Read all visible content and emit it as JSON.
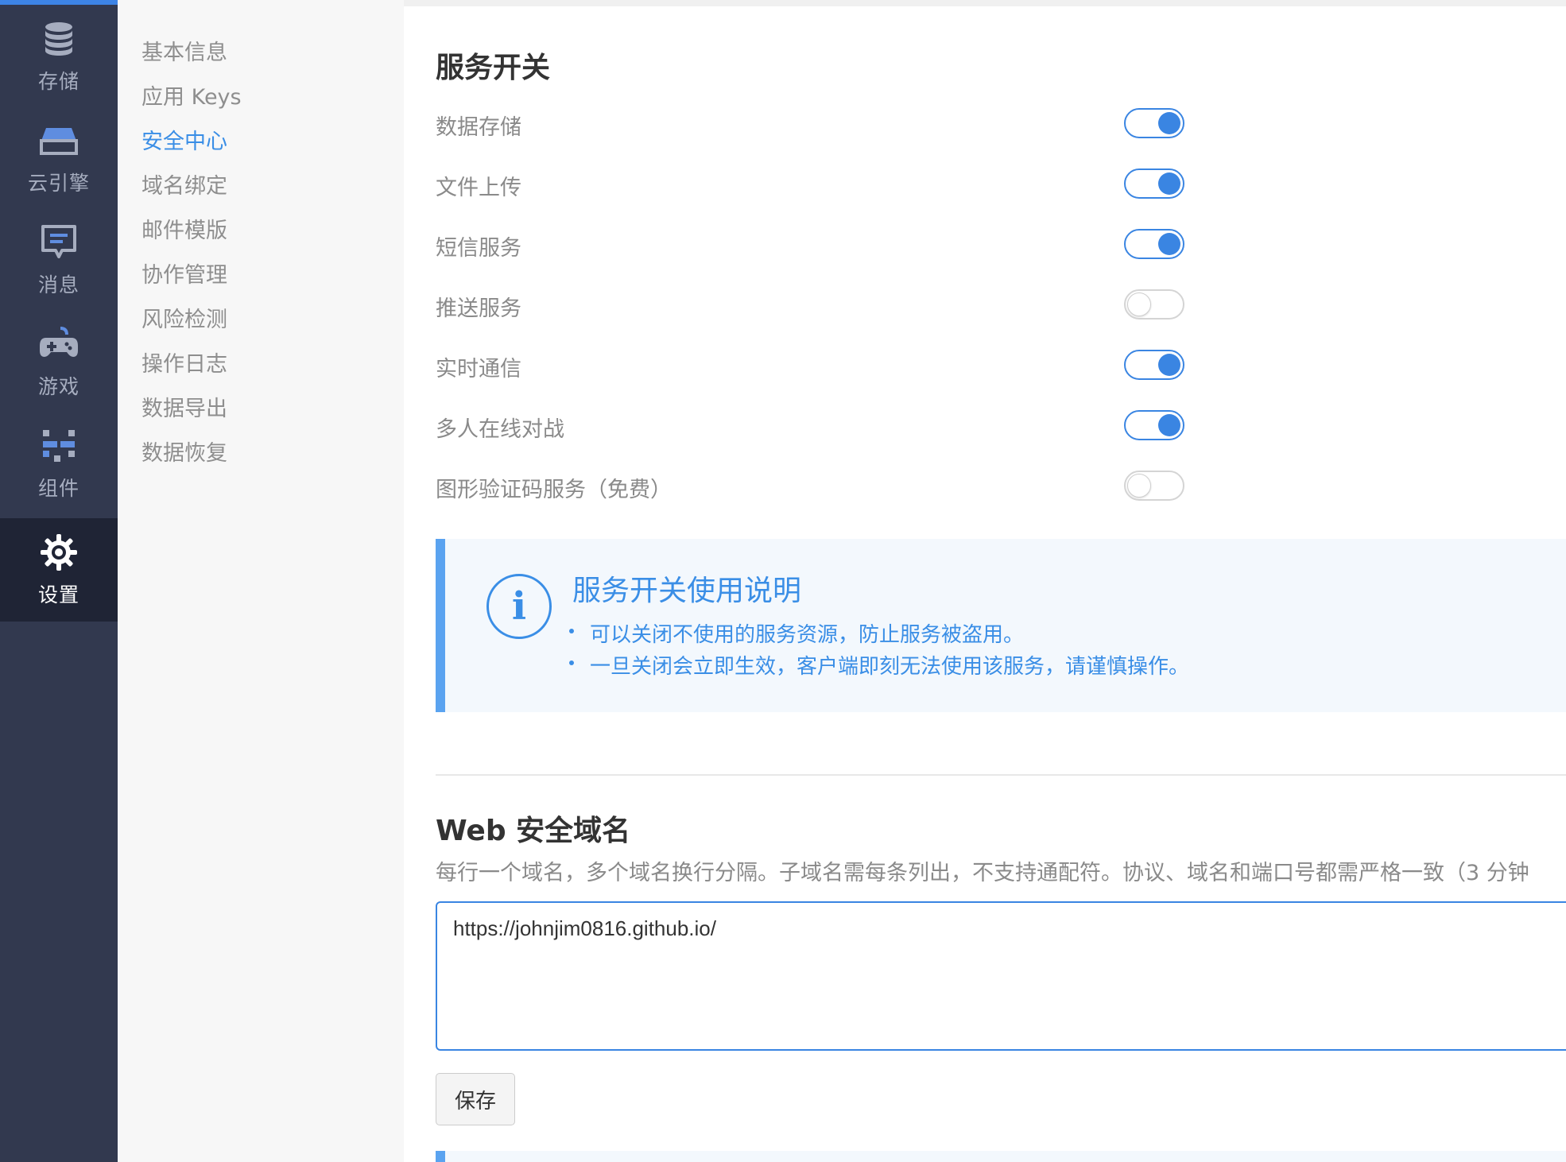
{
  "rail": {
    "items": [
      {
        "label": "存储",
        "icon": "database-icon"
      },
      {
        "label": "云引擎",
        "icon": "server-icon"
      },
      {
        "label": "消息",
        "icon": "message-icon"
      },
      {
        "label": "游戏",
        "icon": "gamepad-icon"
      },
      {
        "label": "组件",
        "icon": "components-icon"
      },
      {
        "label": "设置",
        "icon": "gear-icon",
        "active": true
      }
    ],
    "accent": "#3d84e6",
    "background": "#32394f"
  },
  "subnav": {
    "items": [
      {
        "label": "基本信息"
      },
      {
        "label": "应用 Keys"
      },
      {
        "label": "安全中心",
        "active": true
      },
      {
        "label": "域名绑定"
      },
      {
        "label": "邮件模版"
      },
      {
        "label": "协作管理"
      },
      {
        "label": "风险检测"
      },
      {
        "label": "操作日志"
      },
      {
        "label": "数据导出"
      },
      {
        "label": "数据恢复"
      }
    ]
  },
  "services": {
    "title": "服务开关",
    "items": [
      {
        "label": "数据存储",
        "enabled": true
      },
      {
        "label": "文件上传",
        "enabled": true
      },
      {
        "label": "短信服务",
        "enabled": true
      },
      {
        "label": "推送服务",
        "enabled": false
      },
      {
        "label": "实时通信",
        "enabled": true
      },
      {
        "label": "多人在线对战",
        "enabled": true
      },
      {
        "label": "图形验证码服务（免费）",
        "enabled": false
      }
    ]
  },
  "info": {
    "icon": "info-icon",
    "title": "服务开关使用说明",
    "lines": [
      "可以关闭不使用的服务资源，防止服务被盗用。",
      "一旦关闭会立即生效，客户端即刻无法使用该服务，请谨慎操作。"
    ]
  },
  "web_domains": {
    "title": "Web 安全域名",
    "description": "每行一个域名，多个域名换行分隔。子域名需每条列出，不支持通配符。协议、域名和端口号都需严格一致（3 分钟",
    "value": "https://johnjim0816.github.io/",
    "save_label": "保存"
  }
}
